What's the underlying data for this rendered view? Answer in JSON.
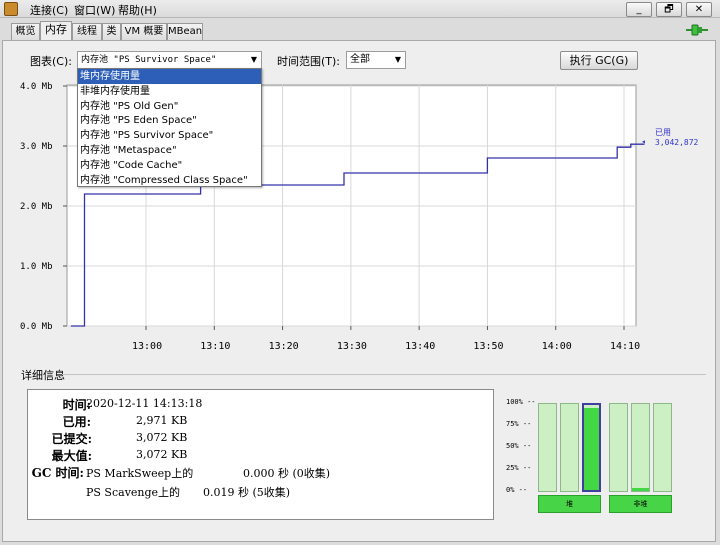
{
  "menu": [
    "连接(C)",
    "窗口(W)",
    "帮助(H)"
  ],
  "window_buttons": {
    "minimize": "_",
    "restore": "🗗",
    "close": "✕"
  },
  "tabs": [
    "概览",
    "内存",
    "线程",
    "类",
    "VM 概要",
    "MBean"
  ],
  "active_tab": "内存",
  "chart_label": "图表(C):",
  "chart_select": "内存池 \"PS Survivor Space\"",
  "time_range_label": "时间范围(T):",
  "time_range_value": "全部",
  "gc_button": "执行 GC(G)",
  "dropdown_options": [
    "堆内存使用量",
    "非堆内存使用量",
    "内存池 \"PS Old Gen\"",
    "内存池 \"PS Eden Space\"",
    "内存池 \"PS Survivor Space\"",
    "内存池 \"Metaspace\"",
    "内存池 \"Code Cache\"",
    "内存池 \"Compressed Class Space\""
  ],
  "dropdown_highlighted": 0,
  "chart_data": {
    "type": "line",
    "ylabel_ticks": [
      "0.0 Mb",
      "1.0 Mb",
      "2.0 Mb",
      "3.0 Mb",
      "4.0 Mb"
    ],
    "xlabel_ticks": [
      "13:00",
      "13:10",
      "13:20",
      "13:30",
      "13:40",
      "13:50",
      "14:00",
      "14:10"
    ],
    "ylim": [
      0,
      4.0
    ],
    "grid": true,
    "series": [
      {
        "name": "已用",
        "color": "#3333aa",
        "points": [
          [
            "12:49",
            0.0
          ],
          [
            "12:51",
            0.0
          ],
          [
            "12:51",
            2.2
          ],
          [
            "13:08",
            2.2
          ],
          [
            "13:08",
            2.35
          ],
          [
            "13:29",
            2.35
          ],
          [
            "13:29",
            2.55
          ],
          [
            "13:50",
            2.55
          ],
          [
            "13:50",
            2.8
          ],
          [
            "14:09",
            2.8
          ],
          [
            "14:09",
            2.98
          ],
          [
            "14:11",
            2.98
          ],
          [
            "14:11",
            3.03
          ],
          [
            "14:13",
            3.03
          ]
        ]
      }
    ],
    "legend_label": "已用",
    "legend_value": "3,042,872"
  },
  "details": {
    "title": "详细信息",
    "time_label": "时间:",
    "time_value": "2020-12-11 14:13:18",
    "used_label": "已用:",
    "used_value": "2,971 KB",
    "committed_label": "已提交:",
    "committed_value": "3,072 KB",
    "max_label": "最大值:",
    "max_value": "3,072 KB",
    "gc_time_label": "GC 时间:",
    "gc1_name": "PS MarkSweep上的",
    "gc1_time": "0.000 秒 (0收集)",
    "gc2_name": "PS Scavenge上的",
    "gc2_time": "0.019 秒 (5收集)"
  },
  "bars": {
    "pct_labels": [
      "100% --",
      "75% --",
      "50% --",
      "25% --",
      "0% --"
    ],
    "heap_fills": [
      0.0,
      0.0,
      0.97
    ],
    "nonheap_fills": [
      0.0,
      0.03,
      0.0
    ],
    "heap_label": "堆",
    "nonheap_label": "非堆"
  }
}
